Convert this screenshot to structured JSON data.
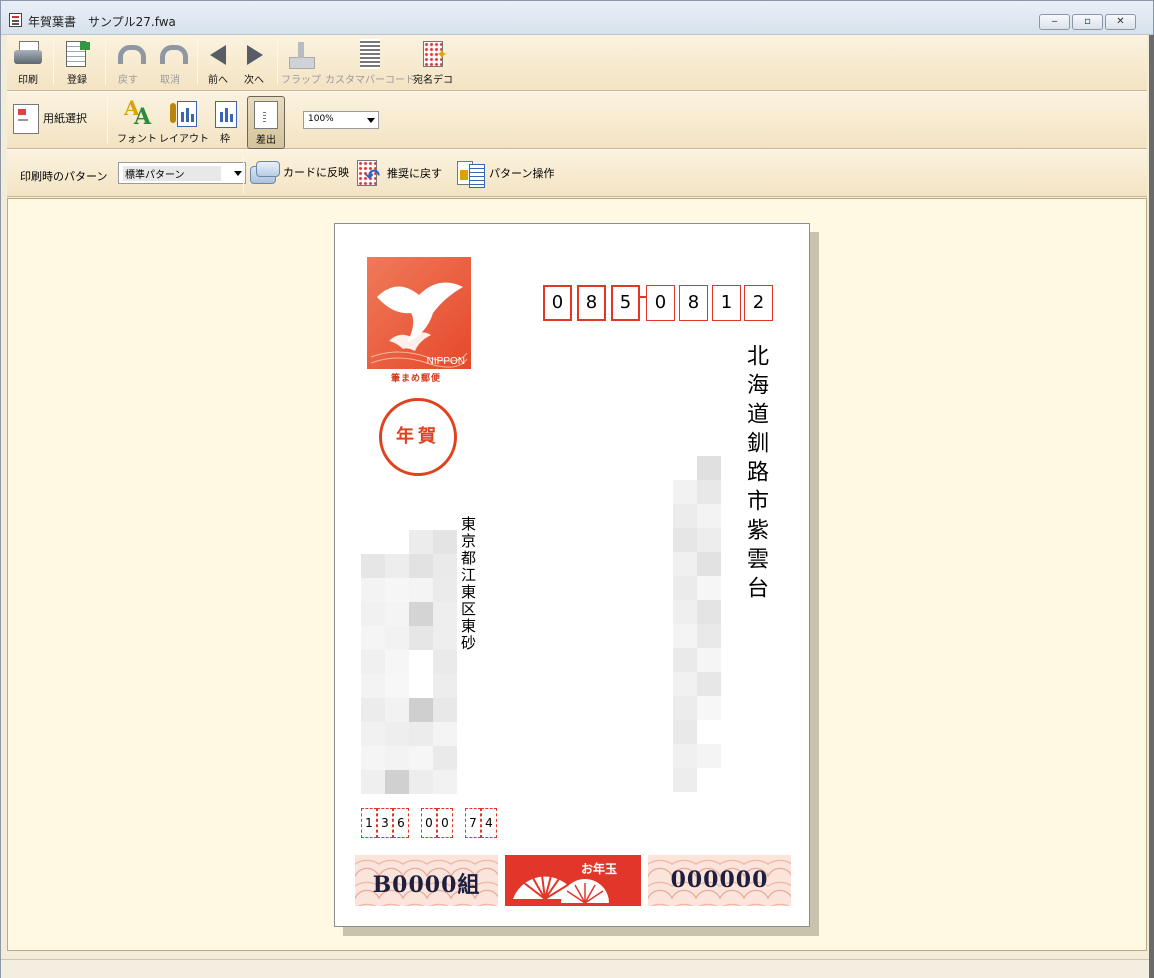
{
  "window": {
    "title": "年賀葉書　サンプル27.fwa",
    "controls": {
      "minimize": "‒",
      "maximize": "▫",
      "close": "✕"
    }
  },
  "toolbar1": {
    "print": "印刷",
    "register": "登録",
    "undo": "戻す",
    "redo": "取消",
    "prev": "前へ",
    "next": "次へ",
    "flap": "フラップ",
    "custom_barcode": "カスタマバーコード",
    "address_deco": "宛名デコ"
  },
  "toolbar2": {
    "paper_select": "用紙選択",
    "font": "フォント",
    "layout": "レイアウト",
    "frame": "枠",
    "sender": "差出",
    "zoom": "100%"
  },
  "toolbar3": {
    "pattern_label": "印刷時のパターン",
    "pattern_value": "標準パターン",
    "apply_card": "カードに反映",
    "reset_recommended": "推奨に戻す",
    "pattern_ops": "パターン操作"
  },
  "postcard": {
    "stamp_text": "NIPPON",
    "stamp_caption": "筆まめ郵便",
    "nenga": "年賀",
    "zip": [
      "0",
      "8",
      "5",
      "0",
      "8",
      "1",
      "2"
    ],
    "address": "北海道釧路市紫雲台",
    "sender_address": "東京都江東区東砂",
    "sender_zip": [
      "1",
      "3",
      "6",
      "0",
      "0",
      "7",
      "4"
    ],
    "lottery_group": "B0000組",
    "lottery_center": "お年玉",
    "lottery_number": "000000"
  },
  "colors": {
    "toolbar": "#f6e8cc",
    "workarea": "#fff9e3",
    "postal_red": "#e2362a"
  }
}
